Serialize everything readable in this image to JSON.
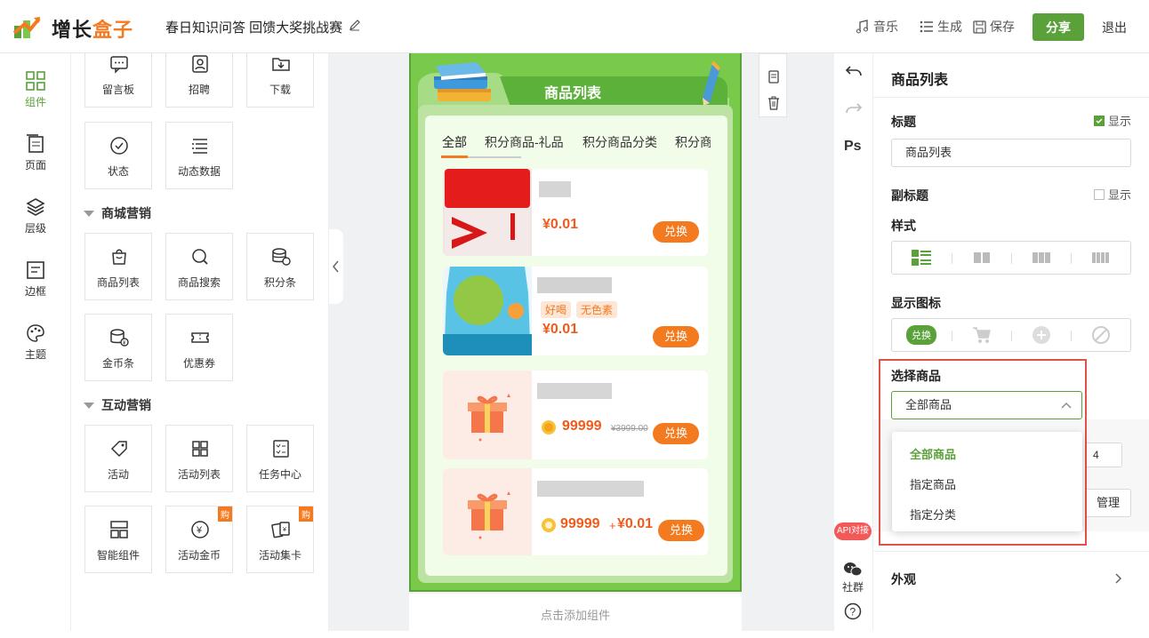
{
  "header": {
    "logo_main": "增长",
    "logo_accent": "盒子",
    "doc_title": "春日知识问答 回馈大奖挑战赛",
    "music": "音乐",
    "generate": "生成",
    "save": "保存",
    "share": "分享",
    "exit": "退出"
  },
  "leftnav": [
    {
      "label": "组件",
      "icon": "grid-icon",
      "active": true
    },
    {
      "label": "页面",
      "icon": "pages-icon"
    },
    {
      "label": "层级",
      "icon": "layers-icon"
    },
    {
      "label": "边框",
      "icon": "border-icon"
    },
    {
      "label": "主题",
      "icon": "palette-icon"
    }
  ],
  "panel": {
    "top_cards": [
      "留言板",
      "招聘",
      "下载",
      "状态",
      "动态数据"
    ],
    "section_mall": "商城营销",
    "mall_cards": [
      "商品列表",
      "商品搜索",
      "积分条",
      "金币条",
      "优惠券"
    ],
    "section_interact": "互动营销",
    "interact_cards": [
      "活动",
      "活动列表",
      "任务中心",
      "智能组件",
      "活动金币",
      "活动集卡"
    ],
    "buy_badge": "购"
  },
  "phone": {
    "banner_title": "商品列表",
    "tabs": [
      "全部",
      "积分商品-礼品",
      "积分商品分类",
      "积分商"
    ],
    "products": [
      {
        "price": "¥0.01",
        "redeem": "兑换"
      },
      {
        "tags": [
          "好喝",
          "无色素"
        ],
        "price": "¥0.01",
        "redeem": "兑换"
      },
      {
        "price": "99999",
        "old_price": "¥3999.00",
        "redeem": "兑换"
      },
      {
        "price": "99999",
        "plus": "+",
        "price2": "¥0.01",
        "redeem": "兑换"
      }
    ],
    "add_component": "点击添加组件"
  },
  "rail": {
    "ps": "Ps",
    "api": "API对接",
    "community": "社群"
  },
  "props": {
    "header": "商品列表",
    "title_label": "标题",
    "show": "显示",
    "title_value": "商品列表",
    "subtitle_label": "副标题",
    "style_label": "样式",
    "icon_label": "显示图标",
    "icon_redeem": "兑换",
    "select_label": "选择商品",
    "select_value": "全部商品",
    "options": [
      "全部商品",
      "指定商品",
      "指定分类"
    ],
    "count_value": "4",
    "manage": "管理",
    "appearance": "外观"
  },
  "colors": {
    "brand_green": "#5aa13a",
    "accent_orange": "#f47a20",
    "highlight_red": "#e0524a"
  }
}
